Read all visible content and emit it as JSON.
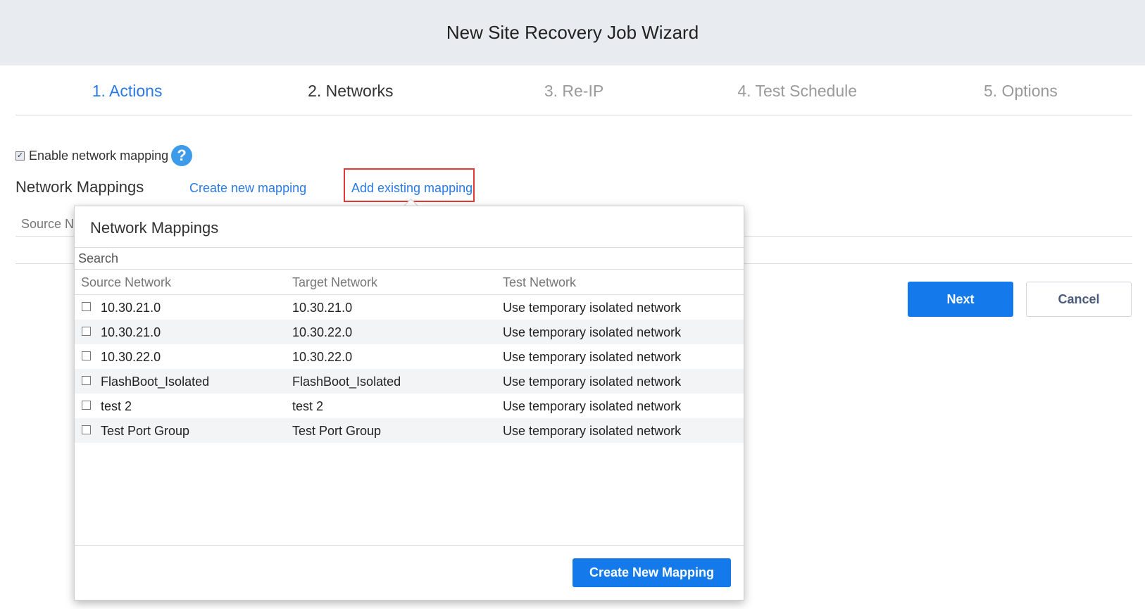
{
  "window": {
    "title": "New Site Recovery Job Wizard"
  },
  "steps": [
    {
      "label": "1. Actions",
      "state": "done"
    },
    {
      "label": "2. Networks",
      "state": "current"
    },
    {
      "label": "3. Re-IP",
      "state": "upcoming"
    },
    {
      "label": "4. Test Schedule",
      "state": "upcoming"
    },
    {
      "label": "5. Options",
      "state": "upcoming"
    }
  ],
  "enable_mapping": {
    "label": "Enable network mapping",
    "checked": true,
    "help_icon": "question-circle-icon",
    "help_glyph": "?"
  },
  "mappings_section": {
    "title": "Network Mappings",
    "create_link": "Create new mapping",
    "add_link": "Add existing mapping",
    "bg_column_header": "Source Ne"
  },
  "buttons": {
    "next": "Next",
    "cancel": "Cancel"
  },
  "popup": {
    "title": "Network Mappings",
    "search_placeholder": "Search",
    "columns": [
      "Source Network",
      "Target Network",
      "Test Network"
    ],
    "rows": [
      {
        "source": "10.30.21.0",
        "target": "10.30.21.0",
        "test": "Use temporary isolated network",
        "checked": false
      },
      {
        "source": "10.30.21.0",
        "target": "10.30.22.0",
        "test": "Use temporary isolated network",
        "checked": false
      },
      {
        "source": "10.30.22.0",
        "target": "10.30.22.0",
        "test": "Use temporary isolated network",
        "checked": false
      },
      {
        "source": "FlashBoot_Isolated",
        "target": "FlashBoot_Isolated",
        "test": "Use temporary isolated network",
        "checked": false
      },
      {
        "source": "test 2",
        "target": "test 2",
        "test": "Use temporary isolated network",
        "checked": false
      },
      {
        "source": "Test Port Group",
        "target": "Test Port Group",
        "test": "Use temporary isolated network",
        "checked": false
      }
    ],
    "create_button": "Create New Mapping"
  },
  "colors": {
    "accent": "#1479ea",
    "link": "#2a7ae2",
    "highlight": "#e53935",
    "header_bg": "#e8ebf0"
  }
}
